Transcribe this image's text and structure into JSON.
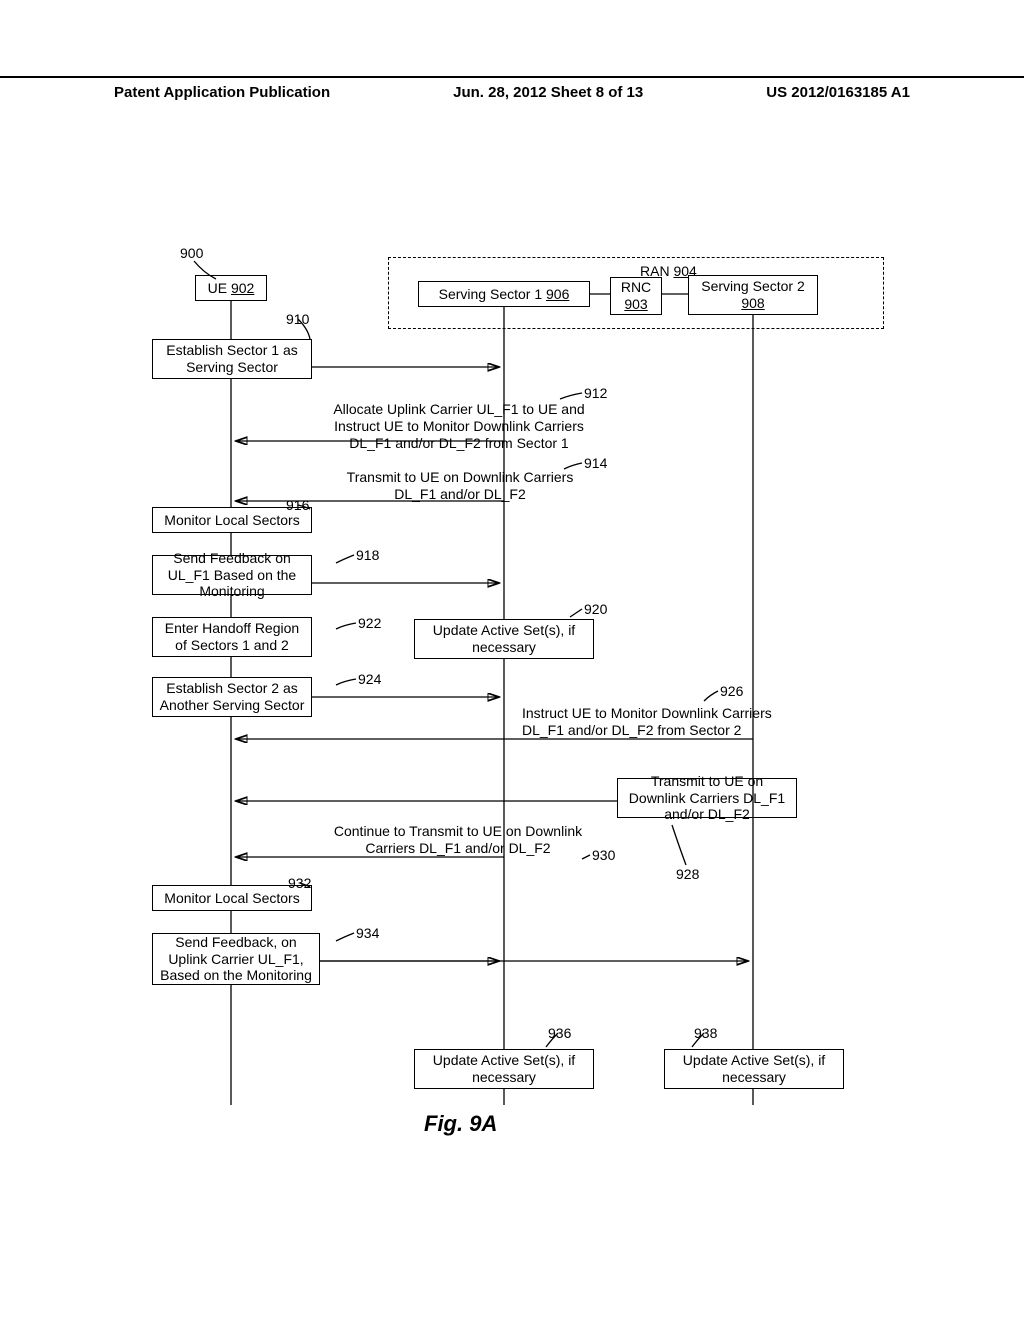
{
  "header": {
    "left": "Patent Application Publication",
    "mid": "Jun. 28, 2012 Sheet 8 of 13",
    "right": "US 2012/0163185 A1"
  },
  "ref": {
    "r900": "900",
    "r910": "910",
    "r912": "912",
    "r914": "914",
    "r916": "916",
    "r918": "918",
    "r920": "920",
    "r922": "922",
    "r924": "924",
    "r926": "926",
    "r928": "928",
    "r930": "930",
    "r932": "932",
    "r934": "934",
    "r936": "936",
    "r938": "938"
  },
  "entities": {
    "ue_label": "UE",
    "ue_num": "902",
    "ran_label": "RAN",
    "ran_num": "904",
    "sector1": "Serving Sector 1",
    "sector1_num": "906",
    "rnc": "RNC",
    "rnc_num": "903",
    "sector2": "Serving Sector 2",
    "sector2_num": "908"
  },
  "steps": {
    "s910": "Establish Sector 1 as Serving Sector",
    "s912": "Allocate Uplink Carrier UL_F1 to UE and Instruct UE to Monitor Downlink Carriers DL_F1 and/or DL_F2 from Sector 1",
    "s914": "Transmit to UE on Downlink Carriers DL_F1 and/or DL_F2",
    "s916": "Monitor Local Sectors",
    "s918": "Send Feedback on UL_F1 Based on the Monitoring",
    "s920": "Update Active Set(s), if necessary",
    "s922": "Enter Handoff Region of Sectors 1 and 2",
    "s924": "Establish Sector 2 as Another Serving Sector",
    "s926": "Instruct UE to Monitor Downlink Carriers DL_F1 and/or DL_F2 from Sector 2",
    "s928": "Transmit to UE on Downlink Carriers DL_F1 and/or DL_F2",
    "s930": "Continue to Transmit to UE on Downlink Carriers DL_F1 and/or DL_F2",
    "s932": "Monitor Local Sectors",
    "s934": "Send Feedback, on Uplink Carrier UL_F1, Based on the Monitoring",
    "s936": "Update Active Set(s), if necessary",
    "s938": "Update Active Set(s), if necessary"
  },
  "caption": "Fig. 9A"
}
